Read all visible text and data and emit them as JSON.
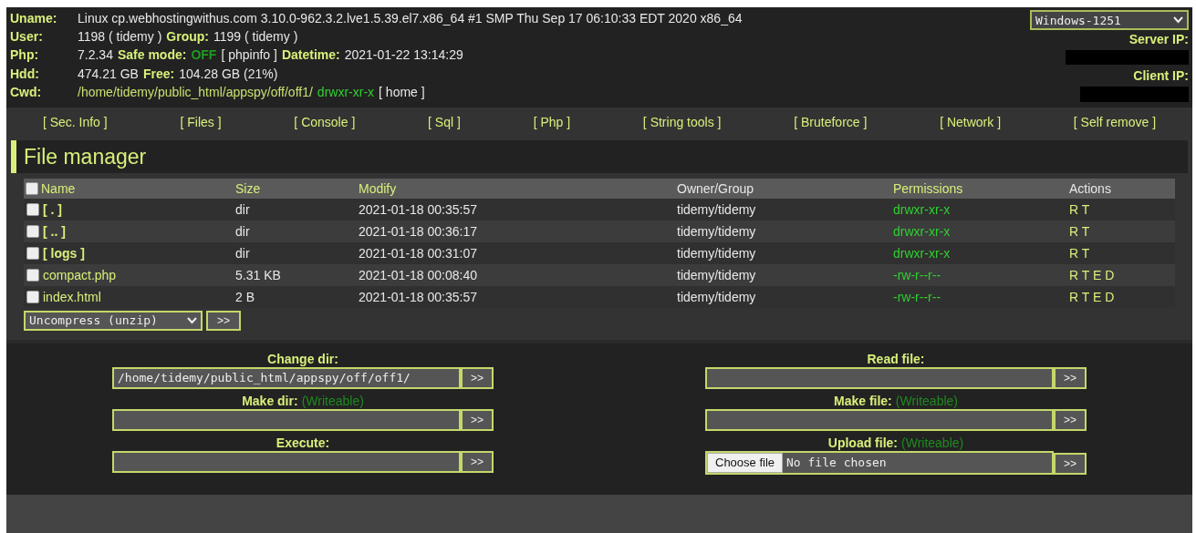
{
  "info": [
    {
      "label": "Uname:",
      "parts": [
        {
          "text": "Linux cp.webhostingwithus.com 3.10.0-962.3.2.lve1.5.39.el7.x86_64 #1 SMP Thu Sep 17 06:10:33 EDT 2020 x86_64",
          "kind": "text"
        }
      ]
    },
    {
      "label": "User:",
      "parts": [
        {
          "text": "1198 ( tidemy )",
          "kind": "text"
        },
        {
          "text": "Group:",
          "kind": "label"
        },
        {
          "text": "1199 ( tidemy )",
          "kind": "text"
        }
      ]
    },
    {
      "label": "Php:",
      "parts": [
        {
          "text": "7.2.34",
          "kind": "text"
        },
        {
          "text": "Safe mode:",
          "kind": "label"
        },
        {
          "text": "OFF",
          "kind": "status"
        },
        {
          "text": "[ phpinfo ]",
          "kind": "link"
        },
        {
          "text": "Datetime:",
          "kind": "label"
        },
        {
          "text": "2021-01-22 13:14:29",
          "kind": "text"
        }
      ]
    },
    {
      "label": "Hdd:",
      "parts": [
        {
          "text": "474.21 GB",
          "kind": "text"
        },
        {
          "text": "Free:",
          "kind": "label"
        },
        {
          "text": "104.28 GB (21%)",
          "kind": "text"
        }
      ]
    },
    {
      "label": "Cwd:",
      "parts": [
        {
          "text": "/home/tidemy/public_html/appspy/off/off1/",
          "kind": "path"
        },
        {
          "text": "drwxr-xr-x",
          "kind": "perm"
        },
        {
          "text": "[ home ]",
          "kind": "link"
        }
      ]
    }
  ],
  "charset": "Windows-1251",
  "server_ip_label": "Server IP:",
  "client_ip_label": "Client IP:",
  "nav": [
    "[ Sec. Info ]",
    "[ Files ]",
    "[ Console ]",
    "[ Sql ]",
    "[ Php ]",
    "[ String tools ]",
    "[ Bruteforce ]",
    "[ Network ]",
    "[ Self remove ]"
  ],
  "section_title": "File manager",
  "table": {
    "columns": [
      "Name",
      "Size",
      "Modify",
      "Owner/Group",
      "Permissions",
      "Actions"
    ],
    "header_checked": false,
    "rows": [
      {
        "name": "[ . ]",
        "kind": "dir",
        "size": "dir",
        "modify": "2021-01-18 00:35:57",
        "owner": "tidemy/tidemy",
        "permissions": "drwxr-xr-x",
        "actions": "R T",
        "checked": false
      },
      {
        "name": "[ .. ]",
        "kind": "dir",
        "size": "dir",
        "modify": "2021-01-18 00:36:17",
        "owner": "tidemy/tidemy",
        "permissions": "drwxr-xr-x",
        "actions": "R T",
        "checked": false
      },
      {
        "name": "[ logs ]",
        "kind": "dir",
        "size": "dir",
        "modify": "2021-01-18 00:31:07",
        "owner": "tidemy/tidemy",
        "permissions": "drwxr-xr-x",
        "actions": "R T",
        "checked": false
      },
      {
        "name": "compact.php",
        "kind": "file",
        "size": "5.31 KB",
        "modify": "2021-01-18 00:08:40",
        "owner": "tidemy/tidemy",
        "permissions": "-rw-r--r--",
        "actions": "R T E D",
        "checked": false
      },
      {
        "name": "index.html",
        "kind": "file",
        "size": "2 B",
        "modify": "2021-01-18 00:35:57",
        "owner": "tidemy/tidemy",
        "permissions": "-rw-r--r--",
        "actions": "R T E D",
        "checked": false
      }
    ]
  },
  "bulk_action": "Uncompress (unzip)",
  "bulk_button": ">>",
  "forms": [
    [
      {
        "label": "Change dir:",
        "kind": "text",
        "value": "/home/tidemy/public_html/appspy/off/off1/",
        "button": ">>"
      },
      {
        "label": "Make dir:",
        "note": "(Writeable)",
        "kind": "text",
        "button": ">>"
      },
      {
        "label": "Execute:",
        "kind": "text",
        "button": ">>"
      }
    ],
    [
      {
        "label": "Read file:",
        "kind": "text",
        "button": ">>"
      },
      {
        "label": "Make file:",
        "note": "(Writeable)",
        "kind": "text",
        "button": ">>"
      },
      {
        "label": "Upload file:",
        "note": "(Writeable)",
        "kind": "file",
        "file_button": "Choose file",
        "file_status": "No file chosen",
        "button": ">>"
      }
    ]
  ]
}
